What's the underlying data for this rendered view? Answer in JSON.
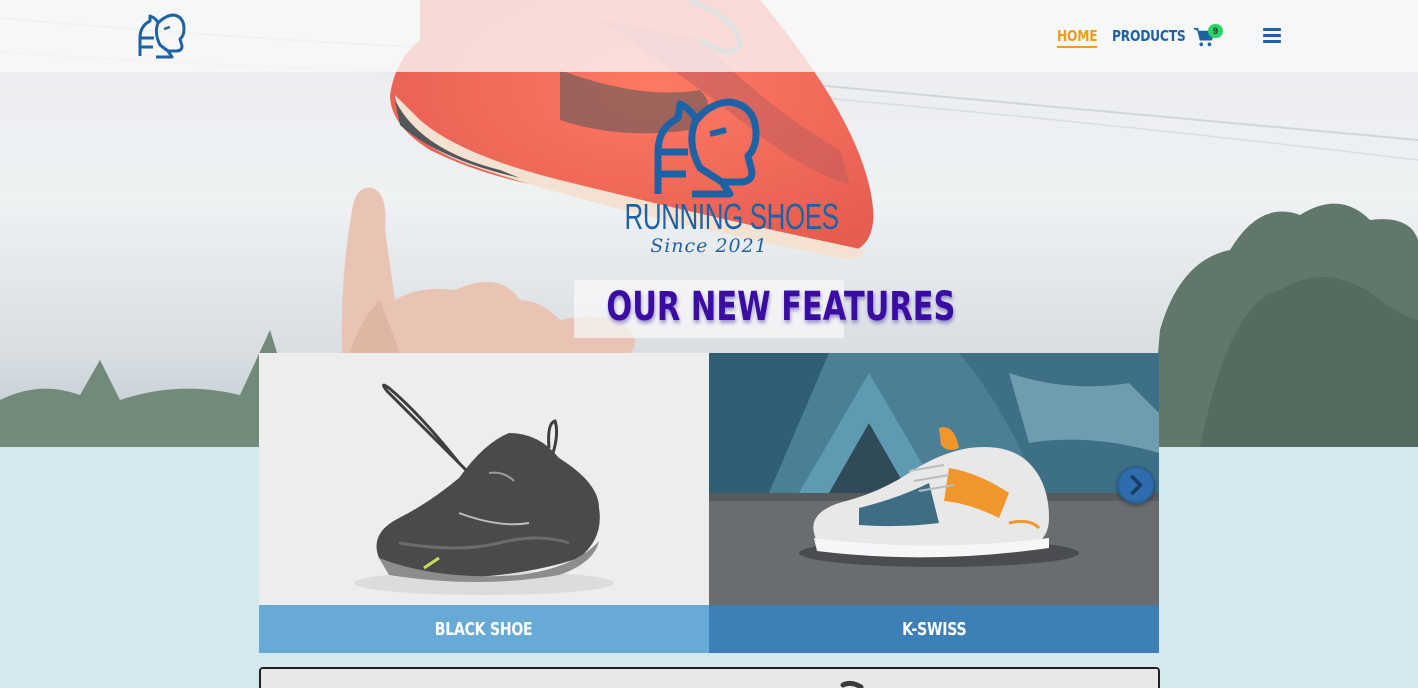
{
  "colors": {
    "brand_blue": "#1e62a6",
    "active_orange": "#f09a1e",
    "title_purple": "#3a0ca3",
    "badge_green": "#2bd467",
    "page_background": "#d4e9ef",
    "card_label_light": "#68aad6",
    "card_label_dark": "#3d7fb7"
  },
  "navbar": {
    "logo_icon": "horse-head-logo-icon",
    "links": [
      {
        "label": "HOME",
        "active": true
      },
      {
        "label": "PRODUCTS",
        "active": false
      }
    ],
    "cart": {
      "icon": "shopping-cart-icon",
      "count": "9"
    },
    "menu_icon": "hamburger-menu-icon"
  },
  "hero": {
    "background": "photo of hand reaching for red running shoe against sky",
    "brand": {
      "logo_icon": "horse-head-logo-icon",
      "name": "RUNNING SHOES",
      "tagline": "Since 2021"
    }
  },
  "features": {
    "title": "OUR NEW FEATURES",
    "items": [
      {
        "label": "BLACK SHOE",
        "image": "black-running-shoe-photo"
      },
      {
        "label": "K-SWISS",
        "image": "k-swiss-sneaker-photo"
      }
    ],
    "next_icon": "chevron-right-icon"
  }
}
